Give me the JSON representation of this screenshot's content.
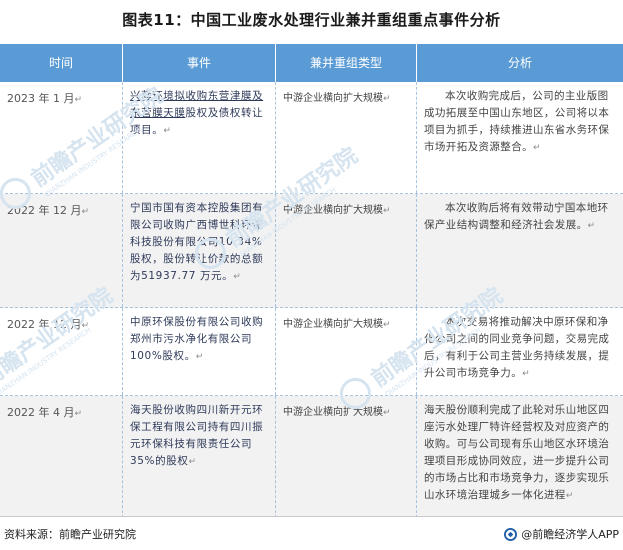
{
  "title": "图表11：中国工业废水处理行业兼并重组重点事件分析",
  "table": {
    "headers": [
      "时间",
      "事件",
      "兼并重组类型",
      "分析"
    ],
    "rows": [
      {
        "time": "2023 年 1 月",
        "event_link": "兴蓉环境拟收购东营津膜及东营膜天膜",
        "event_rest": "股权及债权转让项目。",
        "type": "中游企业横向扩大规模",
        "analysis": "本次收购完成后，公司的主业版图成功拓展至中国山东地区，公司将以本项目为抓手，持续推进山东省水务环保市场开拓及资源整合。"
      },
      {
        "time": "2022 年 12 月",
        "event": "宁国市国有资本控股集团有限公司收购广西博世科环保科技股份有限公司10.34%股权，股份转让价款的总额为51937.77 万元。",
        "type": "中游企业横向扩大规模",
        "analysis": "本次收购后将有效带动宁国本地环保产业结构调整和经济社会发展。"
      },
      {
        "time": "2022 年 12 月",
        "event": "中原环保股份有限公司收购郑州市污水净化有限公司100%股权。",
        "type": "中游企业横向扩大规模",
        "analysis": "本次交易将推动解决中原环保和净化公司之间的同业竞争问题，交易完成后，有利于公司主营业务持续发展，提升公司市场竞争力。"
      },
      {
        "time": "2022 年 4 月",
        "event": "海天股份收购四川新开元环保工程有限公司持有四川振元环保科技有限责任公司35%的股权",
        "type": "中游企业横向扩大规模",
        "analysis": "海天股份顺利完成了此轮对乐山地区四座污水处理厂特许经营权及对应资产的收购。可与公司现有乐山地区水环境治理项目形成协同效应，进一步提升公司的市场占比和市场竞争力，逐步实现乐山水环境治理城乡一体化进程"
      }
    ]
  },
  "paragraph_mark": "↵",
  "footer": {
    "source": "资料来源：前瞻产业研究院",
    "brand": "@前瞻经济学人APP"
  },
  "watermark": {
    "text": "前瞻产业研究院",
    "sub": "QIANZHAN INDUSTRY RESEARCH"
  },
  "colors": {
    "header_bg": "#5b9bd5",
    "row_shade": "#f2f2f2",
    "divider": "#a8c3dd",
    "watermark": "#d6e4f0"
  }
}
